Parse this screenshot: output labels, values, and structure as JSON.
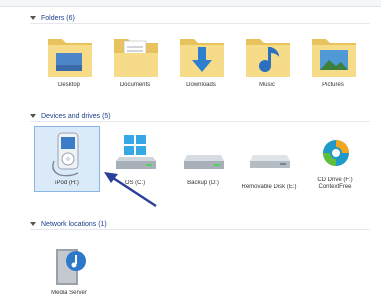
{
  "sections": {
    "folders": {
      "title": "Folders (6)"
    },
    "devices": {
      "title": "Devices and drives (5)"
    },
    "network": {
      "title": "Network locations (1)"
    }
  },
  "folders": [
    {
      "label": "Desktop",
      "icon": "desktop-folder-icon"
    },
    {
      "label": "Documents",
      "icon": "documents-folder-icon"
    },
    {
      "label": "Downloads",
      "icon": "downloads-folder-icon"
    },
    {
      "label": "Music",
      "icon": "music-folder-icon"
    },
    {
      "label": "Pictures",
      "icon": "pictures-folder-icon"
    }
  ],
  "devices": [
    {
      "label": "iPod (H:)",
      "icon": "ipod-device-icon",
      "selected": true
    },
    {
      "label": "OS (C:)",
      "icon": "windows-drive-icon"
    },
    {
      "label": "Backup (D:)",
      "icon": "hard-drive-icon"
    },
    {
      "label": "Removable Disk (E:)",
      "icon": "removable-disk-icon"
    },
    {
      "label": "CD Drive (F:) ContextFree",
      "icon": "cd-drive-icon"
    }
  ],
  "network": [
    {
      "label": "Media Server",
      "icon": "media-server-icon"
    }
  ],
  "colors": {
    "folder": "#f0d47a",
    "selection": "#dbeaf9",
    "header_text": "#1e3f8a",
    "arrow": "#2a3f9a"
  }
}
